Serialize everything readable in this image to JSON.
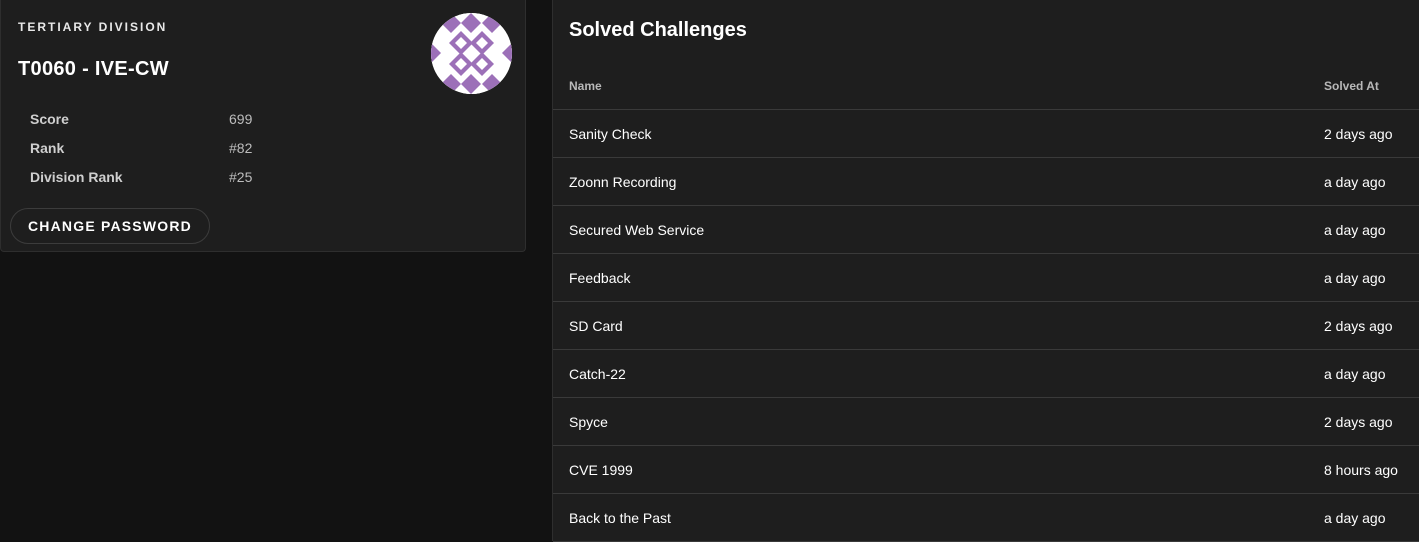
{
  "profile": {
    "division": "TERTIARY DIVISION",
    "team_name": "T0060 - IVE-CW",
    "avatar": {
      "type": "identicon",
      "color": "#9c70b8"
    },
    "stats": [
      {
        "label": "Score",
        "value": "699"
      },
      {
        "label": "Rank",
        "value": "#82"
      },
      {
        "label": "Division Rank",
        "value": "#25"
      }
    ],
    "change_password_label": "CHANGE PASSWORD"
  },
  "solved": {
    "title": "Solved Challenges",
    "columns": {
      "name": "Name",
      "solved_at": "Solved At"
    },
    "rows": [
      {
        "name": "Sanity Check",
        "solved_at": "2 days ago"
      },
      {
        "name": "Zoonn Recording",
        "solved_at": "a day ago"
      },
      {
        "name": "Secured Web Service",
        "solved_at": "a day ago"
      },
      {
        "name": "Feedback",
        "solved_at": "a day ago"
      },
      {
        "name": "SD Card",
        "solved_at": "2 days ago"
      },
      {
        "name": "Catch-22",
        "solved_at": "a day ago"
      },
      {
        "name": "Spyce",
        "solved_at": "2 days ago"
      },
      {
        "name": "CVE 1999",
        "solved_at": "8 hours ago"
      },
      {
        "name": "Back to the Past",
        "solved_at": "a day ago"
      }
    ]
  },
  "colors": {
    "page_bg": "#121212",
    "card_bg": "#1e1e1e",
    "divider": "#3a3a3a",
    "avatar_accent": "#9c70b8"
  }
}
